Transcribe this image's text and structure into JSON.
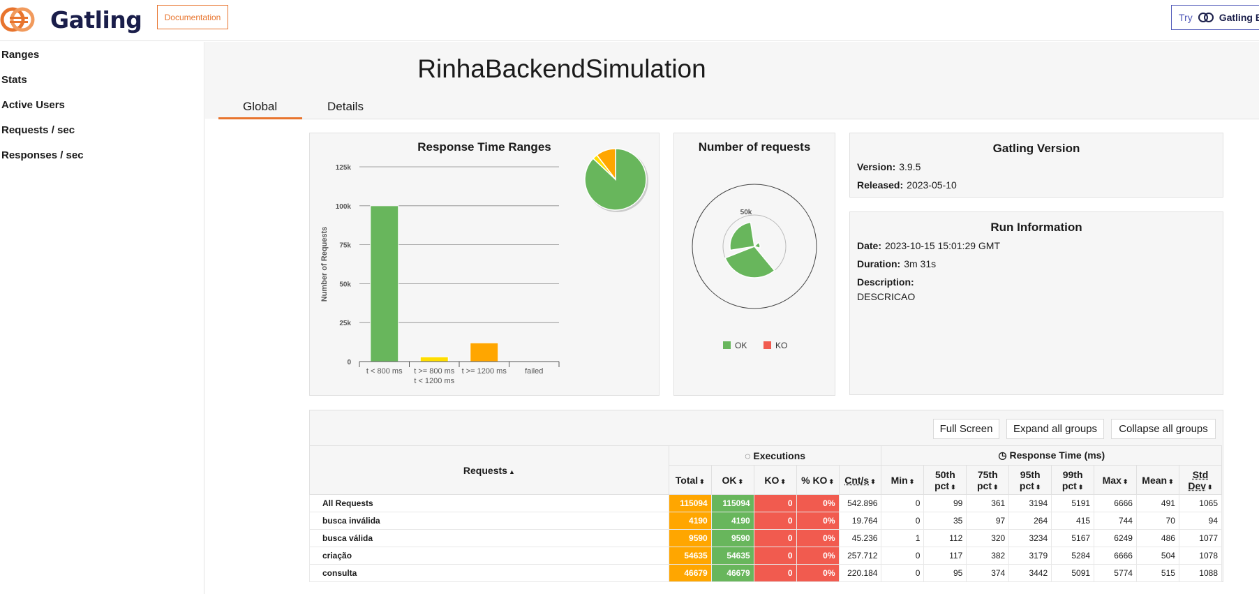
{
  "header": {
    "brand": "Gatling",
    "documentation_label": "Documentation",
    "try_label": "Try",
    "try_brand": "Gatling E"
  },
  "sidebar": {
    "items": [
      {
        "label": "Ranges"
      },
      {
        "label": "Stats"
      },
      {
        "label": "Active Users"
      },
      {
        "label": "Requests / sec"
      },
      {
        "label": "Responses / sec"
      }
    ]
  },
  "page": {
    "title": "RinhaBackendSimulation",
    "tabs": [
      {
        "label": "Global"
      },
      {
        "label": "Details"
      }
    ],
    "active_tab": "Global"
  },
  "colors": {
    "ok": "#68b65c",
    "ko": "#f15b4f",
    "warn": "#ffdd00",
    "slow": "#ffa600",
    "accent": "#e8742d"
  },
  "response_time_ranges": {
    "title": "Response Time Ranges",
    "ylabel": "Number of Requests",
    "chart_data": {
      "type": "bar",
      "title": "Response Time Ranges",
      "ylabel": "Number of Requests",
      "categories": [
        "t < 800 ms",
        "t >= 800 ms t < 1200 ms",
        "t >= 1200 ms",
        "failed"
      ],
      "category_lines": [
        [
          "t < 800 ms"
        ],
        [
          "t >= 800 ms",
          "t < 1200 ms"
        ],
        [
          "t >= 1200 ms"
        ],
        [
          "failed"
        ]
      ],
      "values": [
        100000,
        3000,
        12000,
        0
      ],
      "bar_colors": [
        "#68b65c",
        "#ffdd00",
        "#ffa600",
        "#f15b4f"
      ],
      "yticks": [
        "0",
        "25k",
        "50k",
        "75k",
        "100k",
        "125k"
      ],
      "ylim": [
        0,
        125000
      ],
      "pie": [
        {
          "category": "t < 800 ms",
          "value": 100000,
          "color": "#68b65c"
        },
        {
          "category": "t >= 800 ms t < 1200 ms",
          "value": 3000,
          "color": "#ffdd00"
        },
        {
          "category": "t >= 1200 ms",
          "value": 12000,
          "color": "#ffa600"
        }
      ]
    }
  },
  "number_of_requests": {
    "title": "Number of requests",
    "chart_data": {
      "type": "pie",
      "title": "Number of requests",
      "radial_ticks": [
        "0",
        "50k"
      ],
      "slices": [
        {
          "name": "OK",
          "value": 115094,
          "color": "#68b65c"
        },
        {
          "name": "KO",
          "value": 0,
          "color": "#f15b4f"
        }
      ]
    },
    "legend": [
      {
        "name": "OK",
        "color": "#68b65c"
      },
      {
        "name": "KO",
        "color": "#f15b4f"
      }
    ]
  },
  "gatling_version": {
    "title": "Gatling Version",
    "version_label": "Version:",
    "version": "3.9.5",
    "released_label": "Released:",
    "released": "2023-05-10"
  },
  "run_information": {
    "title": "Run Information",
    "date_label": "Date:",
    "date": "2023-10-15 15:01:29 GMT",
    "duration_label": "Duration:",
    "duration": "3m 31s",
    "description_label": "Description:",
    "description": "DESCRICAO"
  },
  "stats_table": {
    "buttons": {
      "full_screen": "Full Screen",
      "expand": "Expand all groups",
      "collapse": "Collapse all groups"
    },
    "group_requests": "Requests",
    "group_executions": "Executions",
    "group_response_time": "Response Time (ms)",
    "columns": [
      "Total",
      "OK",
      "KO",
      "% KO",
      "Cnt/s",
      "Min",
      "50th pct",
      "75th pct",
      "95th pct",
      "99th pct",
      "Max",
      "Mean",
      "Std Dev"
    ],
    "rows": [
      {
        "name": "All Requests",
        "values": [
          "115094",
          "115094",
          "0",
          "0%",
          "542.896",
          "0",
          "99",
          "361",
          "3194",
          "5191",
          "6666",
          "491",
          "1065"
        ]
      },
      {
        "name": "busca inválida",
        "values": [
          "4190",
          "4190",
          "0",
          "0%",
          "19.764",
          "0",
          "35",
          "97",
          "264",
          "415",
          "744",
          "70",
          "94"
        ]
      },
      {
        "name": "busca válida",
        "values": [
          "9590",
          "9590",
          "0",
          "0%",
          "45.236",
          "1",
          "112",
          "320",
          "3234",
          "5167",
          "6249",
          "486",
          "1077"
        ]
      },
      {
        "name": "criação",
        "values": [
          "54635",
          "54635",
          "0",
          "0%",
          "257.712",
          "0",
          "117",
          "382",
          "3179",
          "5284",
          "6666",
          "504",
          "1078"
        ]
      },
      {
        "name": "consulta",
        "values": [
          "46679",
          "46679",
          "0",
          "0%",
          "220.184",
          "0",
          "95",
          "374",
          "3442",
          "5091",
          "5774",
          "515",
          "1088"
        ]
      }
    ]
  }
}
